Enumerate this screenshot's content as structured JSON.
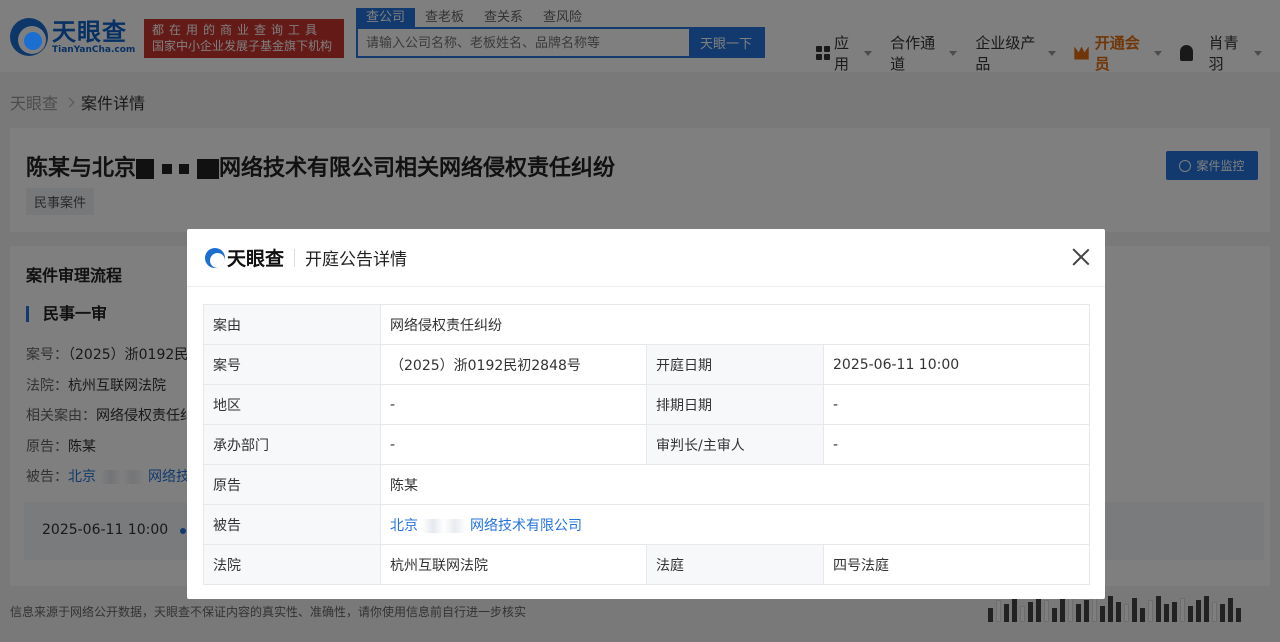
{
  "header": {
    "logo_cn": "天眼查",
    "logo_en": "TianYanCha.com",
    "slogan_line1": "都在用的商业查询工具",
    "slogan_line2": "国家中小企业发展子基金旗下机构",
    "search_tabs": [
      "查公司",
      "查老板",
      "查关系",
      "查风险"
    ],
    "search_placeholder": "请输入公司名称、老板姓名、品牌名称等",
    "search_button": "天眼一下",
    "nav": {
      "apps": "应用",
      "cooperation": "合作通道",
      "enterprise": "企业级产品",
      "vip": "开通会员",
      "user": "肖青羽"
    }
  },
  "breadcrumb": {
    "home": "天眼查",
    "current": "案件详情"
  },
  "case": {
    "title_prefix": "陈某与北京",
    "title_suffix": "网络技术有限公司相关网络侵权责任纠纷",
    "tag": "民事案件",
    "monitor_button": "案件监控"
  },
  "flow": {
    "title": "案件审理流程",
    "stage": "民事一审",
    "lines": {
      "case_no_label": "案号：",
      "case_no_value": "（2025）浙0192民",
      "court_label": "法院：",
      "court_value": "杭州互联网法院",
      "cause_label": "相关案由：",
      "cause_value": "网络侵权责任纠",
      "plaintiff_label": "原告：",
      "plaintiff_value": "陈某",
      "defendant_label": "被告：",
      "defendant_value_a": "北京",
      "defendant_value_b": "网络技"
    },
    "timeline_date": "2025-06-11 10:00"
  },
  "footer_note": "信息来源于网络公开数据，天眼查不保证内容的真实性、准确性，请你使用信息前自行进一步核实",
  "modal": {
    "logo": "天眼查",
    "title": "开庭公告详情",
    "rows": {
      "cause_label": "案由",
      "cause_value": "网络侵权责任纠纷",
      "case_no_label": "案号",
      "case_no_value": "（2025）浙0192民初2848号",
      "hearing_date_label": "开庭日期",
      "hearing_date_value": "2025-06-11 10:00",
      "region_label": "地区",
      "region_value": "-",
      "schedule_label": "排期日期",
      "schedule_value": "-",
      "dept_label": "承办部门",
      "dept_value": "-",
      "judge_label": "审判长/主审人",
      "judge_value": "-",
      "plaintiff_label": "原告",
      "plaintiff_value": "陈某",
      "defendant_label": "被告",
      "defendant_prefix": "北京",
      "defendant_suffix": "网络技术有限公司",
      "court_label": "法院",
      "court_value": "杭州互联网法院",
      "courtroom_label": "法庭",
      "courtroom_value": "四号法庭"
    }
  }
}
